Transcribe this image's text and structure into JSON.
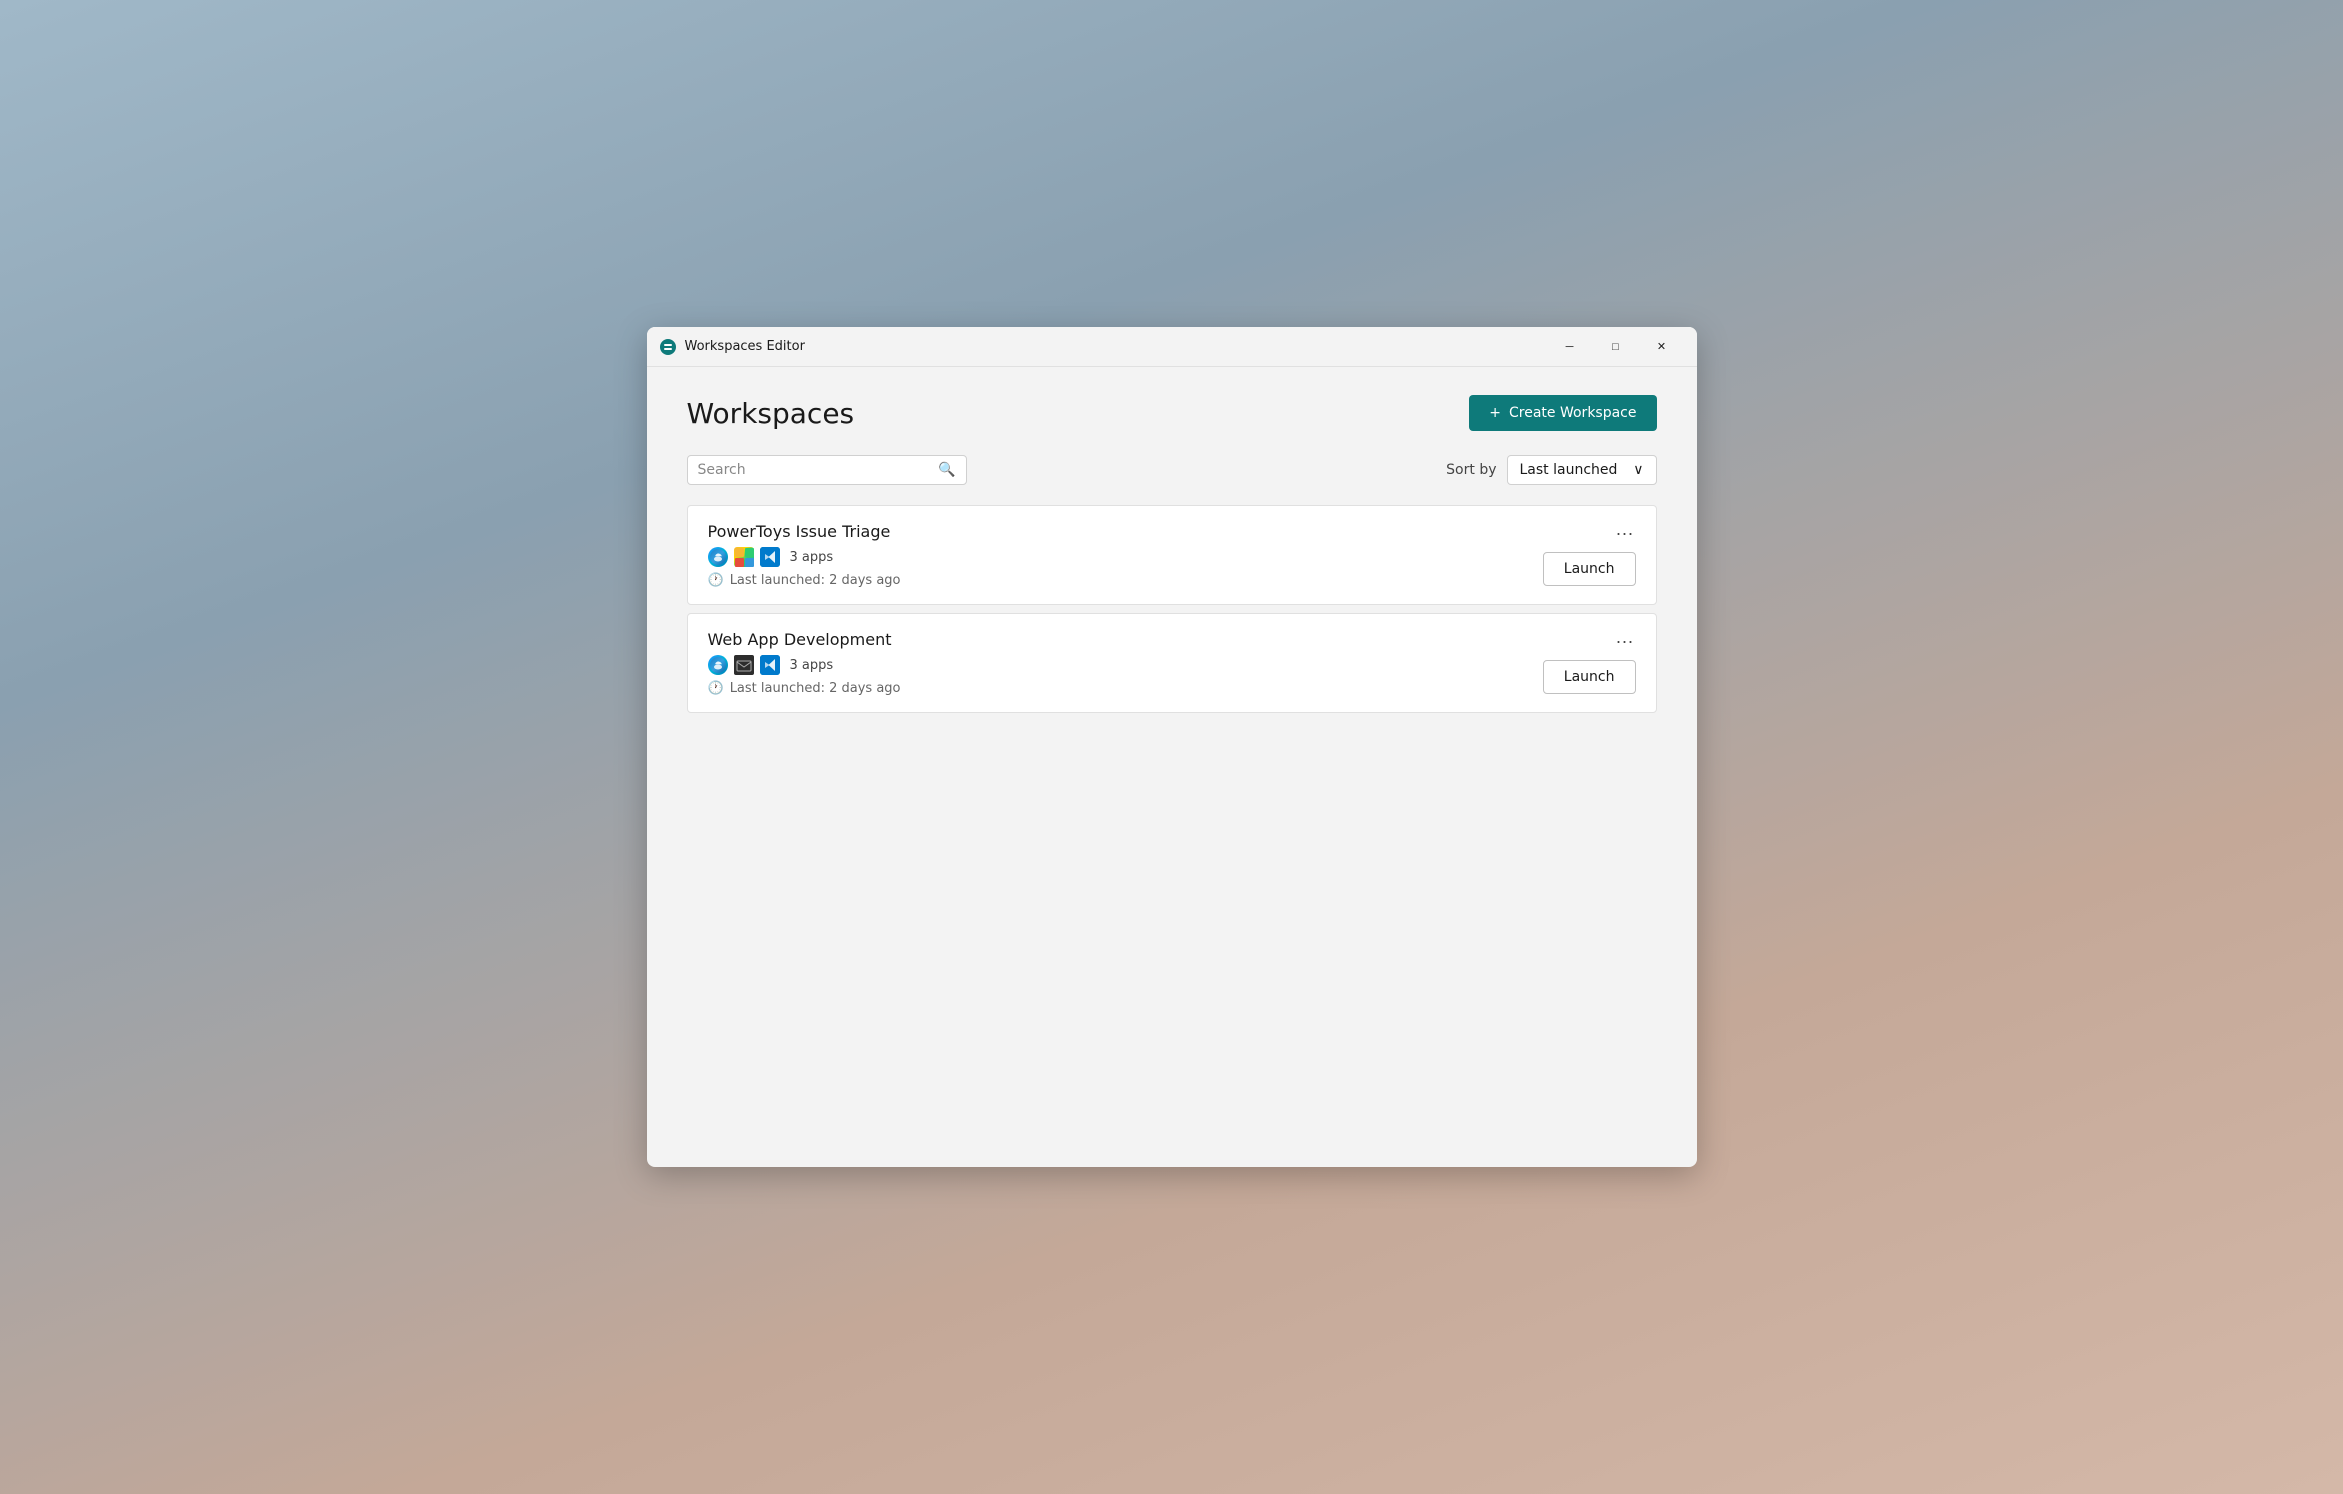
{
  "titlebar": {
    "icon": "workspaces",
    "title": "Workspaces Editor",
    "minimize_label": "─",
    "maximize_label": "□",
    "close_label": "✕"
  },
  "page": {
    "title": "Workspaces"
  },
  "create_button": {
    "label": "Create Workspace",
    "icon": "+"
  },
  "search": {
    "placeholder": "Search",
    "value": ""
  },
  "sort": {
    "label": "Sort by",
    "current": "Last launched",
    "chevron": "∨"
  },
  "workspaces": [
    {
      "name": "PowerToys Issue Triage",
      "apps": [
        {
          "type": "edge",
          "label": "e"
        },
        {
          "type": "store",
          "label": "▦"
        },
        {
          "type": "vscode",
          "label": "⌬"
        }
      ],
      "apps_count": "3 apps",
      "last_launched": "Last launched: 2 days ago",
      "launch_label": "Launch",
      "more_label": "···"
    },
    {
      "name": "Web App Development",
      "apps": [
        {
          "type": "edge",
          "label": "e"
        },
        {
          "type": "mail",
          "label": "✉"
        },
        {
          "type": "vscode",
          "label": "⌬"
        }
      ],
      "apps_count": "3 apps",
      "last_launched": "Last launched: 2 days ago",
      "launch_label": "Launch",
      "more_label": "···"
    }
  ]
}
